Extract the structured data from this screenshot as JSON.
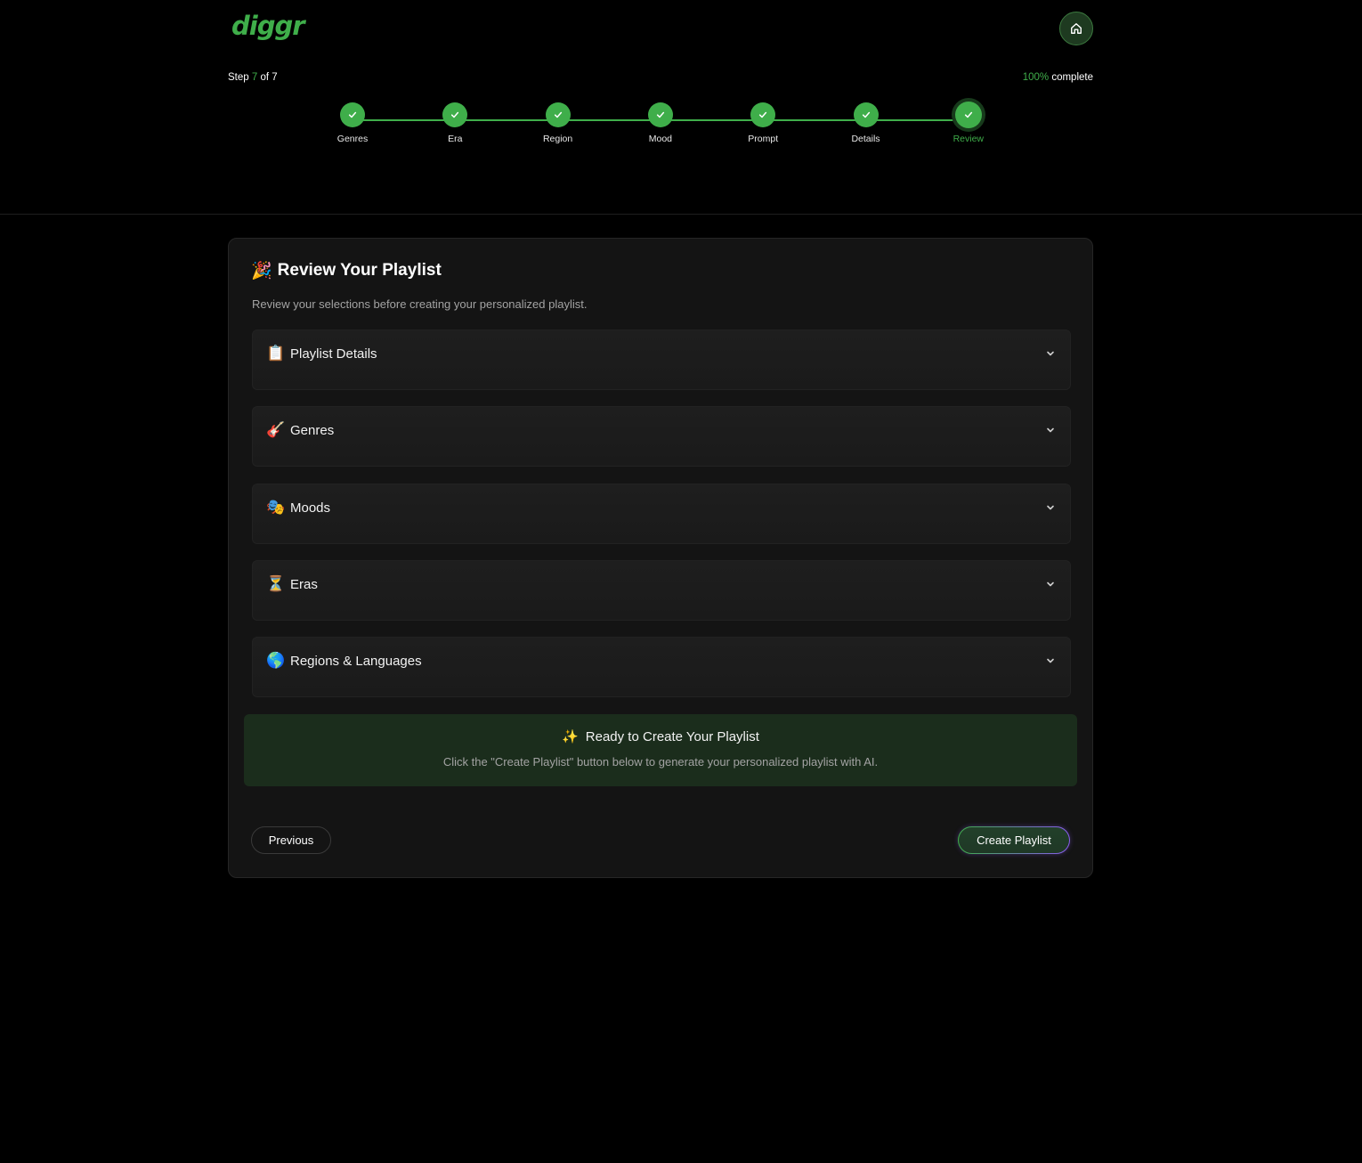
{
  "brand": {
    "logo_text": "diggr",
    "accent_color": "#3fae4a"
  },
  "header": {
    "home_icon": "home-icon"
  },
  "progress": {
    "step_prefix": "Step ",
    "current_step": "7",
    "step_suffix": " of 7",
    "percent": "100%",
    "percent_suffix": " complete",
    "steps": [
      {
        "label": "Genres",
        "status": "done"
      },
      {
        "label": "Era",
        "status": "done"
      },
      {
        "label": "Region",
        "status": "done"
      },
      {
        "label": "Mood",
        "status": "done"
      },
      {
        "label": "Prompt",
        "status": "done"
      },
      {
        "label": "Details",
        "status": "done"
      },
      {
        "label": "Review",
        "status": "current"
      }
    ]
  },
  "review": {
    "title_emoji": "🎉",
    "title": "Review Your Playlist",
    "subtitle": "Review your selections before creating your personalized playlist.",
    "sections": [
      {
        "emoji": "📋",
        "label": "Playlist Details"
      },
      {
        "emoji": "🎸",
        "label": "Genres"
      },
      {
        "emoji": "🎭",
        "label": "Moods"
      },
      {
        "emoji": "⏳",
        "label": "Eras"
      },
      {
        "emoji": "🌎",
        "label": "Regions & Languages"
      }
    ],
    "ready_icon": "✨",
    "ready_title": "Ready to Create Your Playlist",
    "ready_subtitle": "Click the \"Create Playlist\" button below to generate your personalized playlist with AI.",
    "previous_label": "Previous",
    "create_label": "Create Playlist"
  }
}
